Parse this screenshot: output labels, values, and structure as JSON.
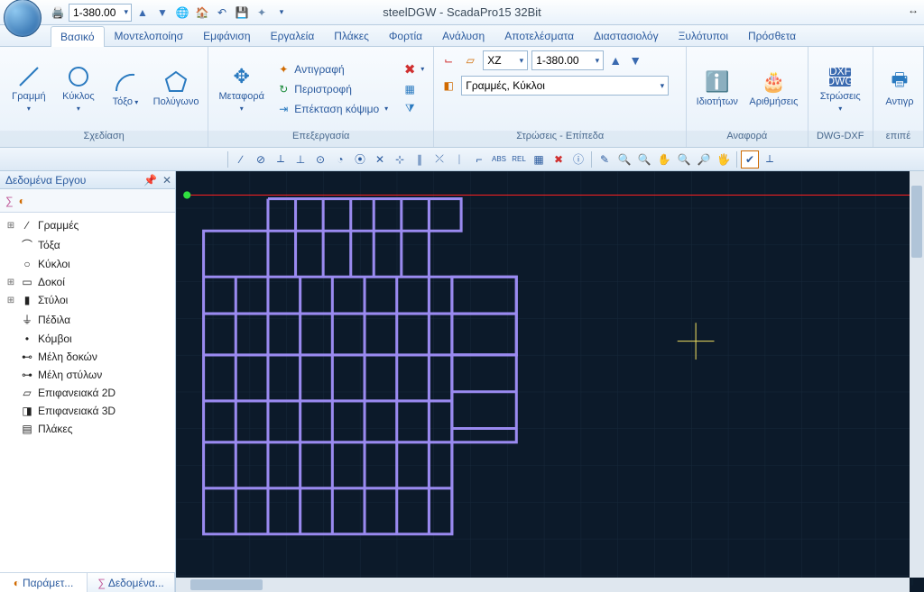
{
  "app": {
    "title": "steelDGW - ScadaPro15 32Bit"
  },
  "qat": {
    "level_value": "1-380.00"
  },
  "ribbon_tabs": [
    "Βασικό",
    "Μοντελοποίησ",
    "Εμφάνιση",
    "Εργαλεία",
    "Πλάκες",
    "Φορτία",
    "Ανάλυση",
    "Αποτελέσματα",
    "Διαστασιολόγ",
    "Ξυλότυποι",
    "Πρόσθετα"
  ],
  "ribbon_active_tab": 0,
  "groups": {
    "draw": {
      "label": "Σχεδίαση",
      "items": {
        "line": "Γραμμή",
        "circle": "Κύκλος",
        "arc": "Τόξο",
        "polygon": "Πολύγωνο"
      }
    },
    "edit": {
      "label": "Επεξεργασία",
      "move": "Μεταφορά",
      "copy": "Αντιγραφή",
      "rotate": "Περιστροφή",
      "extend": "Επέκταση κόψιμο"
    },
    "layers": {
      "label": "Στρώσεις - Επίπεδα",
      "plane": "XZ",
      "level": "1-380.00",
      "current_layer": "Γραμμές, Κύκλοι"
    },
    "report": {
      "label": "Αναφορά",
      "props": "Ιδιοτήτων",
      "numbering": "Αριθμήσεις"
    },
    "dwg": {
      "label": "DWG-DXF",
      "layers": "Στρώσεις"
    },
    "copy2": {
      "btn": "Αντιγρ",
      "sub": "επιπέ"
    }
  },
  "sidebar": {
    "title": "Δεδομένα Εργου",
    "items": [
      {
        "label": "Γραμμές",
        "exp": "⊞"
      },
      {
        "label": "Τόξα",
        "exp": ""
      },
      {
        "label": "Κύκλοι",
        "exp": ""
      },
      {
        "label": "Δοκοί",
        "exp": "⊞"
      },
      {
        "label": "Στύλοι",
        "exp": "⊞"
      },
      {
        "label": "Πέδιλα",
        "exp": ""
      },
      {
        "label": "Κόμβοι",
        "exp": ""
      },
      {
        "label": "Μέλη δοκών",
        "exp": ""
      },
      {
        "label": "Μέλη στύλων",
        "exp": ""
      },
      {
        "label": "Επιφανειακά 2D",
        "exp": ""
      },
      {
        "label": "Επιφανειακά 3D",
        "exp": ""
      },
      {
        "label": "Πλάκες",
        "exp": ""
      }
    ],
    "bottom_tabs": {
      "left": "Παράμετ...",
      "right": "Δεδομένα..."
    }
  }
}
